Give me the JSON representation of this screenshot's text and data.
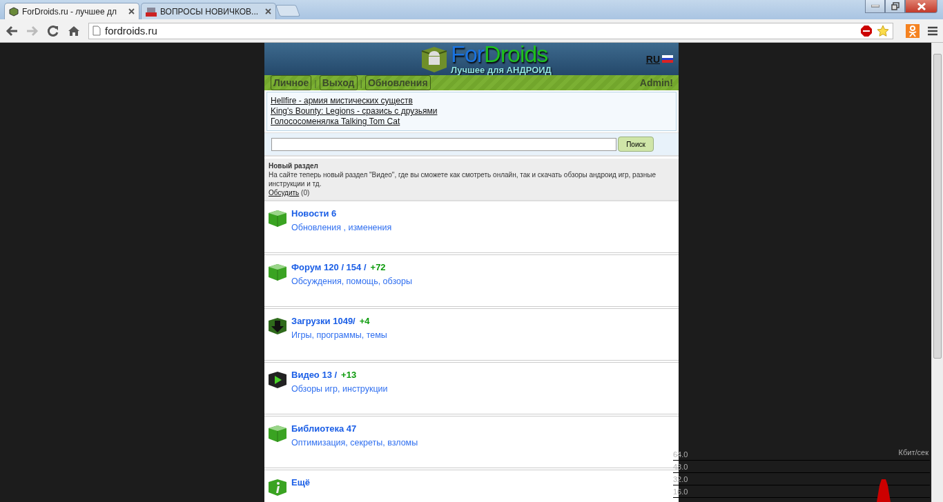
{
  "browser": {
    "tabs": [
      {
        "title": "ForDroids.ru - лучшее дл",
        "selected": true,
        "kind": "cube"
      },
      {
        "title": "ВОПРОСЫ НОВИЧКОВ...",
        "selected": false,
        "kind": "cms"
      }
    ],
    "address": "fordroids.ru"
  },
  "header": {
    "logo_title_blue": "For",
    "logo_title_green": "Droids",
    "logo_subtitle": "Лучшее для АНДРОИД",
    "language": "RU"
  },
  "nav": {
    "buttons": [
      "Личное",
      "Выход",
      "Обновления"
    ],
    "separator": "|",
    "user": "Admin!"
  },
  "featured_links": [
    "Hellfire - армия мистических существ",
    "King's Bounty: Legions - сразись с друзьями",
    "Голососоменялка Talking Tom Cat"
  ],
  "search": {
    "button": "Поиск"
  },
  "notice": {
    "title": "Новый раздел",
    "text": "На сайте теперь новый раздел \"Видео\", где вы сможете как смотреть онлайн, так и скачать обзоры андроид игр, разные инструкции и тд.",
    "link": "Обсудить",
    "count": "(0)"
  },
  "sections": [
    {
      "kind": "cube",
      "title": "Новости 6",
      "subtitle": "Обновления , изменения"
    },
    {
      "kind": "cube",
      "title": "Форум 120 / 154 /",
      "delta": "+72",
      "subtitle": "Обсуждения, помощь, обзоры"
    },
    {
      "kind": "download",
      "title": "Загрузки 1049/",
      "delta": "+4",
      "subtitle": "Игры, программы, темы"
    },
    {
      "kind": "play",
      "title": "Видео 13 /",
      "delta": "+13",
      "subtitle": "Обзоры игр, инструкции"
    },
    {
      "kind": "cube",
      "title": "Библиотека 47",
      "subtitle": "Оптимизация, секреты, взломы"
    },
    {
      "kind": "info",
      "title": "Ещё"
    }
  ],
  "traffic_widget": {
    "unit": "Кбит/сек",
    "ticks": [
      "64.0",
      "48.0",
      "32.0",
      "16.0"
    ]
  }
}
